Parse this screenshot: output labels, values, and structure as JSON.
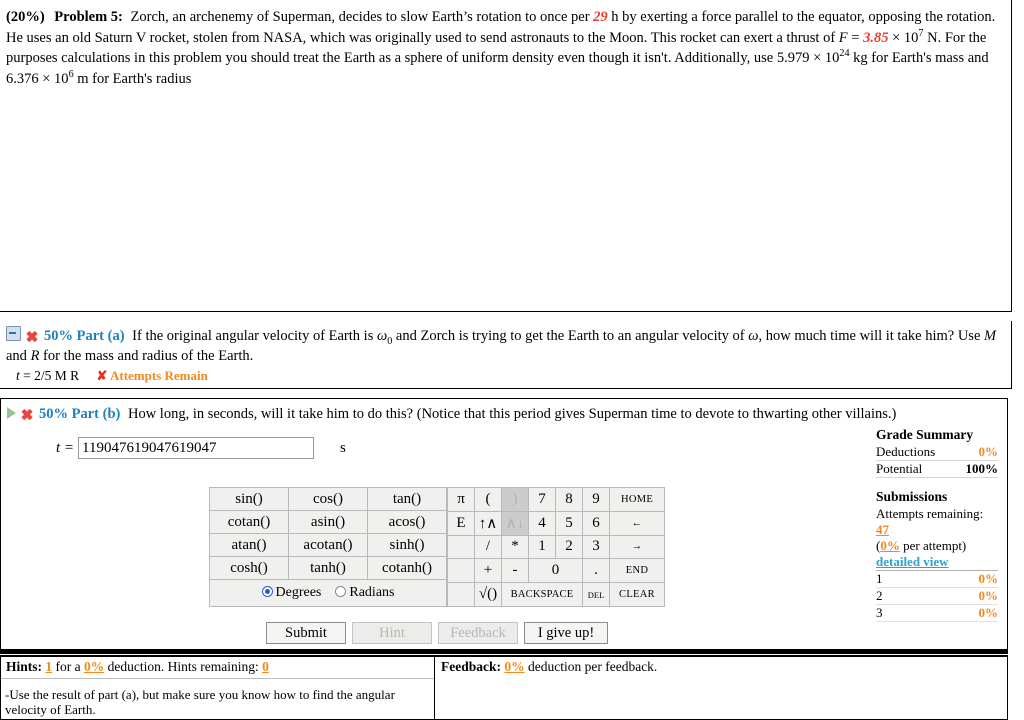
{
  "problem": {
    "weight": "(20%)",
    "label": "Problem 5:",
    "seg1": "Zorch, an archenemy of Superman, decides to slow Earth’s rotation to once per ",
    "hours": "29",
    "seg2": " h by exerting a force parallel to the equator, opposing the rotation. He uses an old Saturn V rocket, stolen from NASA, which was originally used to send astronauts to the Moon. This rocket can exert a thrust of ",
    "var_F": "F",
    "eq": " = ",
    "thrust_mantissa": "3.85",
    "thrust_times": " × 10",
    "thrust_exp": "7",
    "seg3": " N. For the purposes calculations in this problem you should treat the Earth as a sphere of uniform density even though it isn't. Additionally, use ",
    "mass_mantissa": "5.979 × 10",
    "mass_exp": "24",
    "seg4": " kg for Earth's mass and ",
    "radius_mantissa": "6.376 × 10",
    "radius_exp": "6",
    "seg5": " m for Earth's radius"
  },
  "part_a": {
    "collapse_icon": "minus-box-icon",
    "status_icon": "red-x-burst-icon",
    "percent": "50%",
    "label": "Part (a)",
    "question_1": "If the original angular velocity of Earth is ",
    "omega0_var": "ω",
    "omega0_sub": "0",
    "question_2": " and Zorch is trying to get the Earth to an angular velocity of ",
    "omega_var": "ω",
    "question_3": ", how much time will it take him? Use ",
    "var_M": "M",
    "question_4": " and ",
    "var_R": "R",
    "question_5": " for the mass and radius of the Earth.",
    "answer_var": "t",
    "answer_eq": " = ",
    "answer_value": "2/5 M R",
    "attempts_mark": "✘",
    "attempts_text": "Attempts Remain"
  },
  "part_b": {
    "expand_icon": "green-triangle-icon",
    "status_icon": "red-x-burst-icon",
    "percent": "50%",
    "label": "Part (b)",
    "question": "How long, in seconds, will it take him to do this? (Notice that this period gives Superman time to devote to thwarting other villains.)",
    "answer_var": "t",
    "answer_eq": " = ",
    "input_value": "119047619047619047",
    "input_placeholder": "",
    "unit": "s"
  },
  "calculator": {
    "functions": [
      [
        "sin()",
        "cos()",
        "tan()"
      ],
      [
        "cotan()",
        "asin()",
        "acos()"
      ],
      [
        "atan()",
        "acotan()",
        "sinh()"
      ],
      [
        "cosh()",
        "tanh()",
        "cotanh()"
      ]
    ],
    "angle_mode": {
      "selected": "Degrees",
      "options": [
        "Degrees",
        "Radians"
      ]
    },
    "keypad": [
      [
        "π",
        "(",
        ")",
        "7",
        "8",
        "9",
        "HOME"
      ],
      [
        "E",
        "↑∧",
        "∧↓",
        "4",
        "5",
        "6",
        "←"
      ],
      [
        "",
        "/",
        "*",
        "1",
        "2",
        "3",
        "→"
      ],
      [
        "",
        "+",
        "-",
        "0",
        ".",
        "END"
      ],
      [
        "",
        "√()",
        "BACKSPACE",
        "DEL",
        "CLEAR"
      ]
    ],
    "disabled_keys": [
      ")",
      "∧↓"
    ]
  },
  "buttons": {
    "submit": "Submit",
    "hint": "Hint",
    "feedback": "Feedback",
    "give_up": "I give up!"
  },
  "grade_summary": {
    "title": "Grade Summary",
    "rows": [
      {
        "label": "Deductions",
        "value": "0%",
        "accent": true
      },
      {
        "label": "Potential",
        "value": "100%",
        "accent": false
      }
    ],
    "submissions_title": "Submissions",
    "attempts_label": "Attempts remaining:",
    "attempts_value": "47",
    "per_attempt_open": "(",
    "per_attempt_value": "0%",
    "per_attempt_close": " per attempt)",
    "detailed_view": "detailed view",
    "attempt_rows": [
      {
        "num": "1",
        "value": "0%"
      },
      {
        "num": "2",
        "value": "0%"
      },
      {
        "num": "3",
        "value": "0%"
      }
    ]
  },
  "hints": {
    "title": "Hints:",
    "count": "1",
    "for_a": "for a",
    "deduction_pct": "0%",
    "deduction_word": "deduction. Hints remaining:",
    "remaining": "0",
    "body": "-Use the result of part (a), but make sure you know how to find the angular velocity of Earth."
  },
  "feedback": {
    "title": "Feedback:",
    "deduction_pct": "0%",
    "text": "deduction per feedback."
  },
  "colors": {
    "accent_orange": "#f08a20",
    "link_blue": "#1f7fbf",
    "problem_red": "#ee3b2b",
    "status_red": "#e8453c",
    "radio_blue": "#1a62d0"
  }
}
